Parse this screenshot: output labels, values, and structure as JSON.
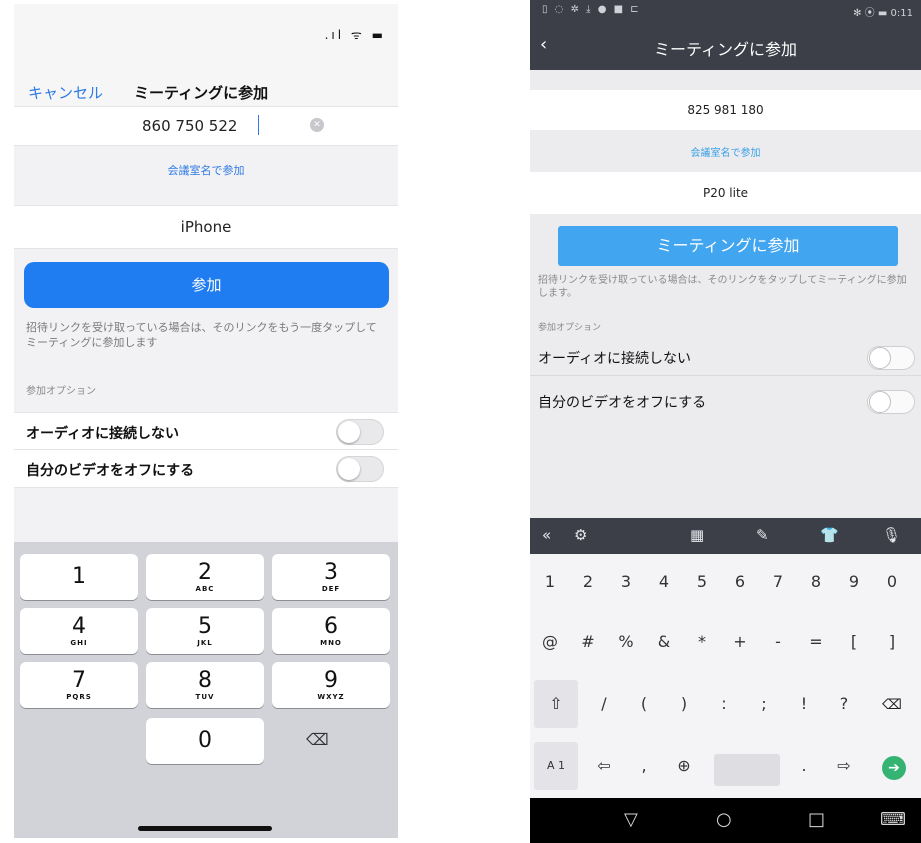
{
  "ios": {
    "status_icons": ".ıl ᯤ ▬",
    "nav": {
      "cancel": "キャンセル",
      "title": "ミーティングに参加"
    },
    "meeting_id": "860 750 522",
    "clear_glyph": "✕",
    "room_link": "会議室名で参加",
    "display_name": "iPhone",
    "join_button": "参加",
    "hint": "招待リンクを受け取っている場合は、そのリンクをもう一度タップしてミーティングに参加します",
    "options_label": "参加オプション",
    "options": [
      {
        "label": "オーディオに接続しない"
      },
      {
        "label": "自分のビデオをオフにする"
      }
    ],
    "keypad": [
      {
        "num": "1",
        "letters": ""
      },
      {
        "num": "2",
        "letters": "ABC"
      },
      {
        "num": "3",
        "letters": "DEF"
      },
      {
        "num": "4",
        "letters": "GHI"
      },
      {
        "num": "5",
        "letters": "JKL"
      },
      {
        "num": "6",
        "letters": "MNO"
      },
      {
        "num": "7",
        "letters": "PQRS"
      },
      {
        "num": "8",
        "letters": "TUV"
      },
      {
        "num": "9",
        "letters": "WXYZ"
      },
      {
        "num": "0",
        "letters": ""
      }
    ],
    "backspace_glyph": "⌫"
  },
  "android": {
    "status_left": "▯ ◌ ✲ ⤓ ● ■ ⊏",
    "status_right": "✻ ⦿ ▬ 0:11",
    "nav": {
      "back": "‹",
      "title": "ミーティングに参加"
    },
    "meeting_id": "825 981 180",
    "room_link": "会議室名で参加",
    "display_name": "P20 lite",
    "join_button": "ミーティングに参加",
    "hint": "招待リンクを受け取っている場合は、そのリンクをタップしてミーティングに参加します。",
    "options_label": "参加オプション",
    "options": [
      {
        "label": "オーディオに接続しない"
      },
      {
        "label": "自分のビデオをオフにする"
      }
    ],
    "toolbar": {
      "collapse": "«",
      "settings": "⚙",
      "keyboard": "▦",
      "edit": "✎",
      "skin": "👕",
      "mic": "🎙"
    },
    "keys_row1": [
      "1",
      "2",
      "3",
      "4",
      "5",
      "6",
      "7",
      "8",
      "9",
      "0"
    ],
    "keys_row2": [
      "@",
      "#",
      "%",
      "&",
      "*",
      "+",
      "-",
      "=",
      "[",
      "]"
    ],
    "keys_row3": [
      "⇧",
      "/",
      "(",
      ")",
      ":",
      ";",
      "!",
      "?"
    ],
    "keys_row4": [
      "A 1",
      "⇦",
      ",",
      "⊕",
      ".",
      "⇨"
    ],
    "delete_glyph": "⌫",
    "go_glyph": "➔",
    "sys_nav": {
      "back": "▽",
      "home": "○",
      "recents": "□",
      "keyboard": "⌨"
    }
  }
}
